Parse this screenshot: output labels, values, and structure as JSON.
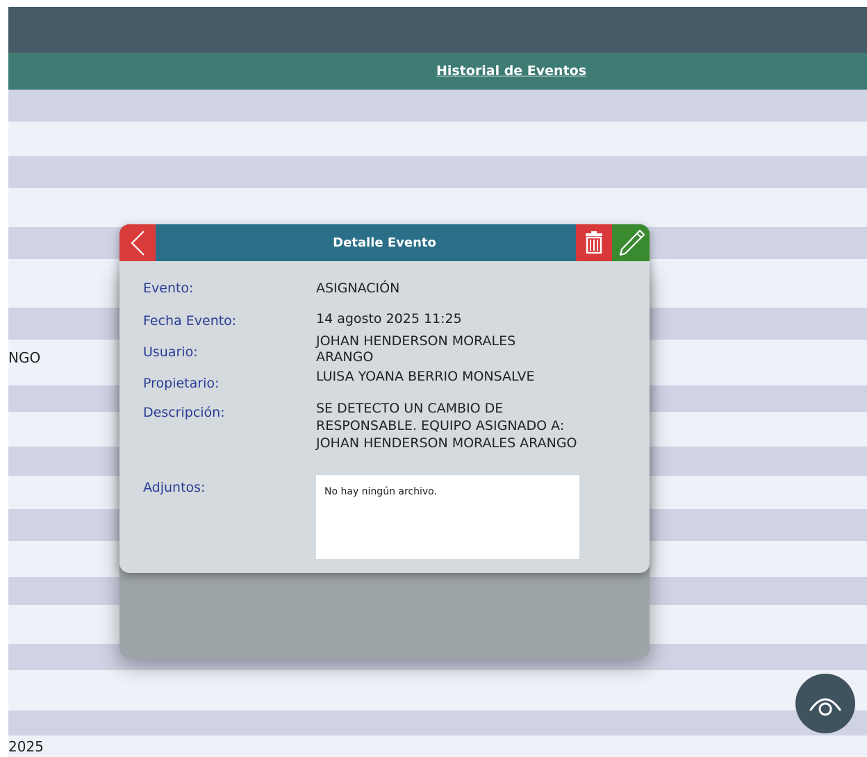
{
  "header": {
    "title": "Historial de Eventos"
  },
  "background": {
    "row_texts": [
      "NGO",
      "2025"
    ]
  },
  "modal": {
    "title": "Detalle Evento",
    "fields": {
      "evento_label": "Evento:",
      "evento_value": "ASIGNACIÓN",
      "fecha_label": "Fecha Evento:",
      "fecha_value": "14 agosto 2025 11:25",
      "usuario_label": "Usuario:",
      "usuario_value": "JOHAN HENDERSON MORALES ARANGO",
      "propietario_label": "Propietario:",
      "propietario_value": "LUISA YOANA BERRIO MONSALVE",
      "descripcion_label": "Descripción:",
      "descripcion_value": "SE DETECTO UN CAMBIO DE RESPONSABLE. EQUIPO ASIGNADO A: JOHAN HENDERSON MORALES ARANGO",
      "adjuntos_label": "Adjuntos:",
      "adjuntos_value": "No hay ningún archivo."
    },
    "icons": {
      "back": "chevron-left-icon",
      "delete": "trash-icon",
      "edit": "pencil-icon"
    }
  },
  "fab": {
    "icon": "eye-icon"
  },
  "colors": {
    "topbar": "#455b66",
    "subbar": "#3d7b73",
    "modal_header": "#2a6f87",
    "back": "#d93b3b",
    "delete": "#d8383a",
    "edit": "#3a8a30",
    "label": "#2b3c96",
    "row_dark": "#cfd3e4",
    "row_light": "#eef2f8"
  }
}
